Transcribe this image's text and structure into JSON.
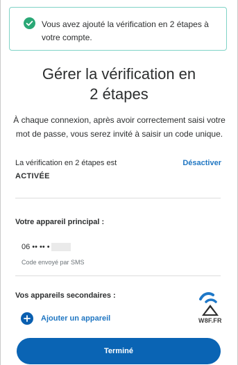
{
  "alert": {
    "icon": "check-circle-icon",
    "color": "#2aa876",
    "text": "Vous avez ajouté la vérification en 2 étapes à votre compte."
  },
  "page": {
    "title_line1": "Gérer la vérification en",
    "title_line2": "2 étapes",
    "description": "À chaque connexion, après avoir correctement saisi votre mot de passe, vous serez invité à saisir un code unique."
  },
  "status": {
    "label": "La vérification en 2 étapes est",
    "value": "ACTIVÉE",
    "action": "Désactiver"
  },
  "primary_device": {
    "heading": "Votre appareil principal :",
    "number": "06 •• •• •",
    "note": "Code envoyé par SMS"
  },
  "secondary_devices": {
    "heading": "Vos appareils secondaires :",
    "add_label": "Ajouter un appareil",
    "add_icon": "plus-circle-icon"
  },
  "footer": {
    "done_label": "Terminé",
    "accent": "#0a64b4"
  },
  "watermark": {
    "text": "W8F.FR",
    "icon": "w8f-logo"
  }
}
